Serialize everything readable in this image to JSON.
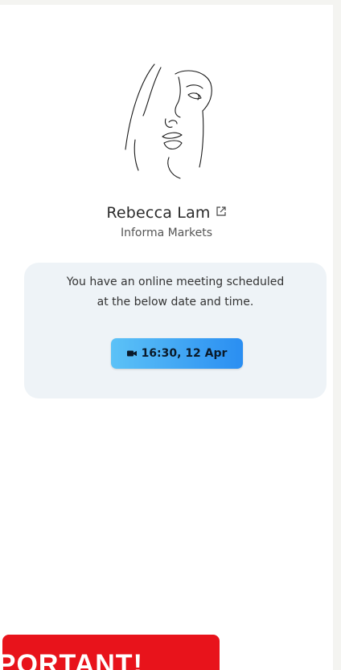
{
  "contact": {
    "name": "Rebecca Lam",
    "company": "Informa Markets"
  },
  "meeting": {
    "line1": "You have an online meeting scheduled",
    "line2": "at the below date and time.",
    "time_label": "16:30, 12 Apr"
  },
  "banner": {
    "text": "IMPORTANT!"
  },
  "icons": {
    "avatar": "line-art-face-icon",
    "external_link": "external-link-icon",
    "video": "video-camera-icon"
  },
  "colors": {
    "button_start": "#5cc2f7",
    "button_end": "#2a8ef2",
    "banner": "#e8131b",
    "card_bg": "#eef3f7"
  }
}
